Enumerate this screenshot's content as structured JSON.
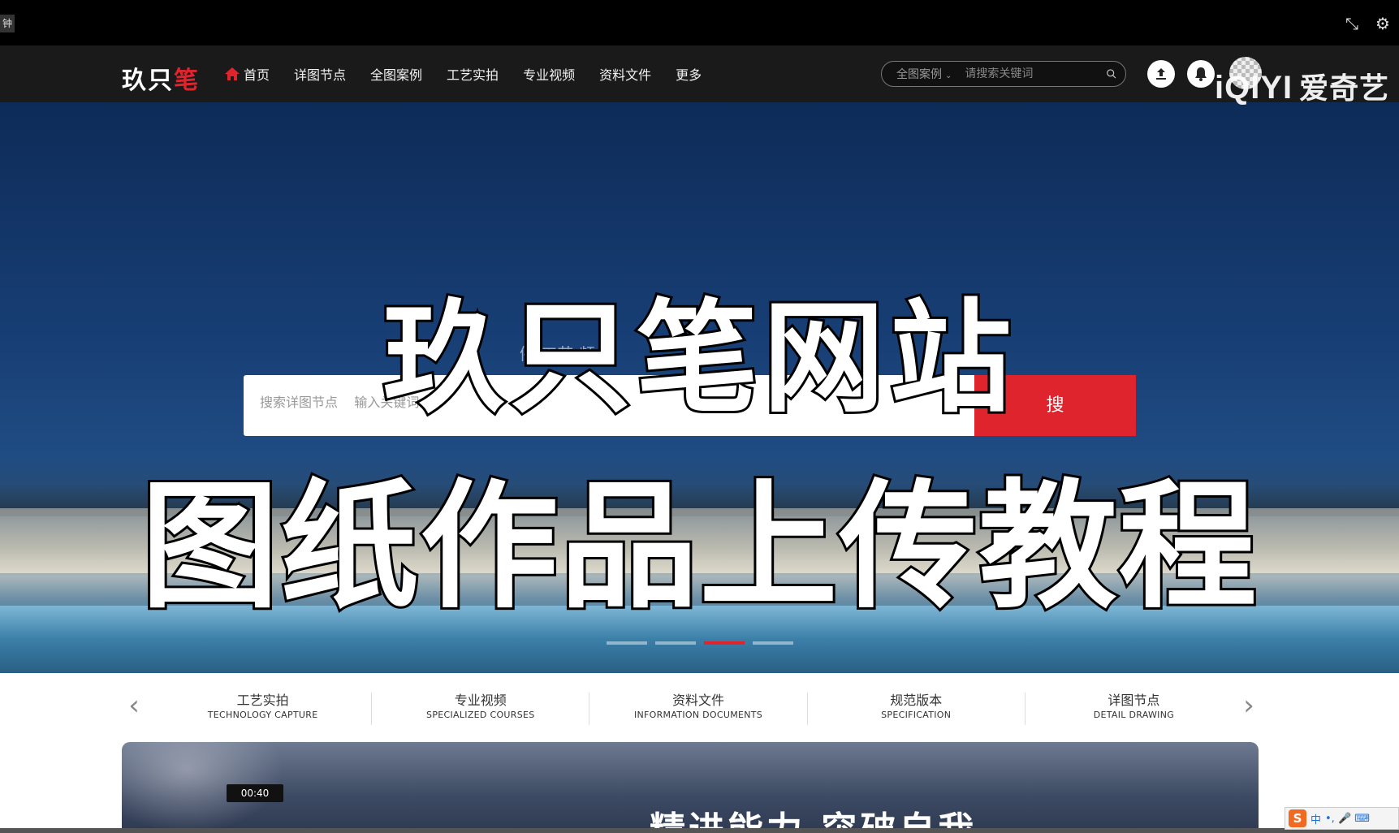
{
  "player": {
    "corner_tag": "钟",
    "collapse_icon": "collapse-icon",
    "settings_icon": "settings-icon"
  },
  "header": {
    "logo": {
      "main": "玖只",
      "accent": "笔"
    },
    "nav": [
      "首页",
      "详图节点",
      "全图案例",
      "工艺实拍",
      "专业视频",
      "资料文件",
      "更多"
    ],
    "search": {
      "scope": "全图案例",
      "placeholder": "请搜索关键词"
    },
    "upload_icon": "upload-icon",
    "bell_icon": "bell-icon"
  },
  "watermark": {
    "brand": "iQIYI",
    "brand_cn": "爱奇艺"
  },
  "hero": {
    "faint_tabs": "例   工艺   频   资",
    "search_placeholder": "搜索详图节点    输入关键词",
    "search_button": "搜",
    "overlay_line1": "玖只笔网站",
    "overlay_line2": "图纸作品上传教程",
    "slides": 4,
    "active_slide": 2
  },
  "categories": [
    {
      "cn": "工艺实拍",
      "en": "TECHNOLOGY CAPTURE"
    },
    {
      "cn": "专业视频",
      "en": "SPECIALIZED COURSES"
    },
    {
      "cn": "资料文件",
      "en": "INFORMATION DOCUMENTS"
    },
    {
      "cn": "规范版本",
      "en": "SPECIFICATION"
    },
    {
      "cn": "详图节点",
      "en": "DETAIL DRAWING"
    }
  ],
  "video": {
    "time": "00:40",
    "caption": "精进能力 突破自我",
    "progress": 0
  },
  "ime": {
    "logo": "S",
    "lang": "中",
    "items": "•, 🎤 ⌨"
  },
  "colors": {
    "accent": "#e0242d",
    "header_bg": "#1a1a1a",
    "hero_blue": "#173e74"
  }
}
